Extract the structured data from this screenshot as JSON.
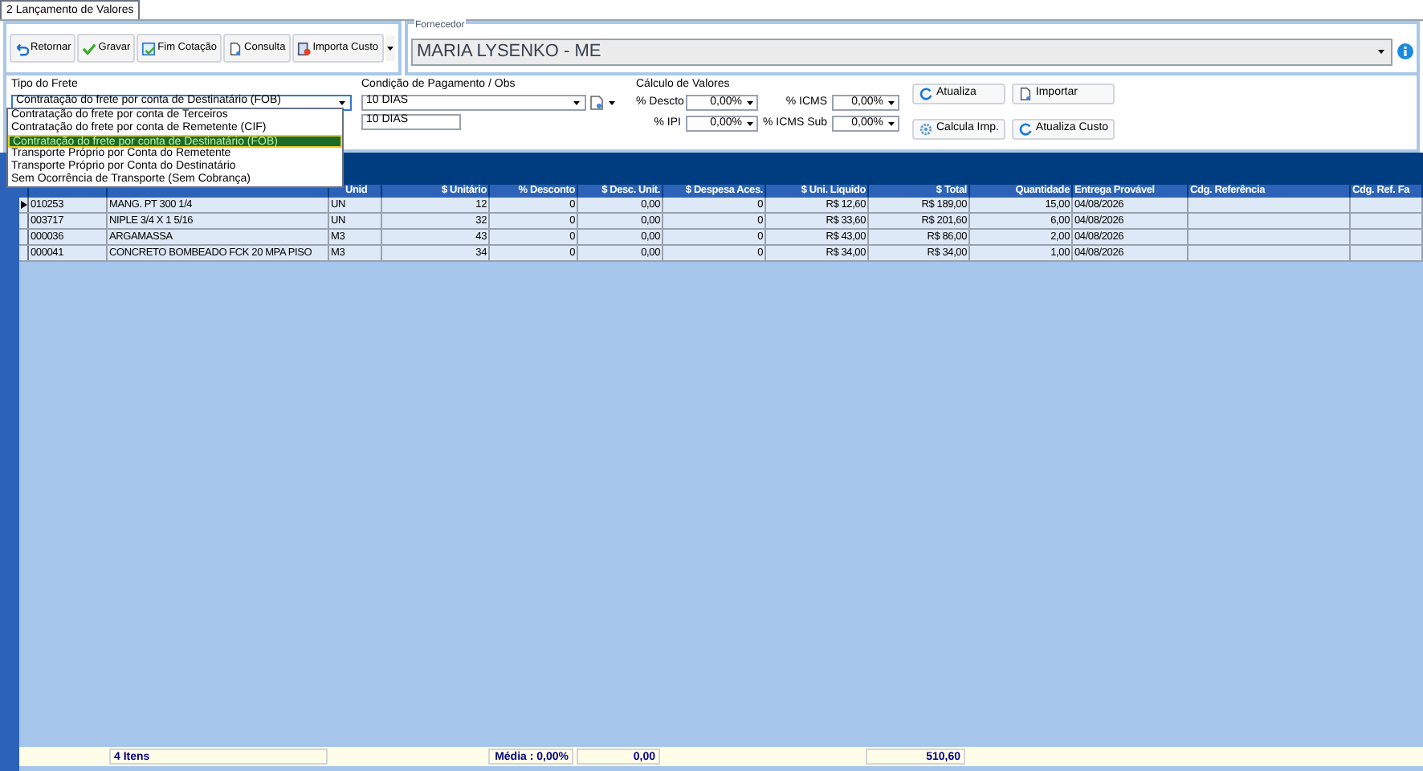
{
  "tabs": [
    {
      "label": "2 Lançamento de Valores",
      "selected": true
    }
  ],
  "toolbar": [
    {
      "label": "Retornar"
    },
    {
      "label": "Gravar"
    },
    {
      "label": "Fim Cotação"
    },
    {
      "label": "Consulta"
    },
    {
      "label": "Importa Custo"
    }
  ],
  "fornecedor": {
    "label": "Fornecedor",
    "value": "MARIA LYSENKO - ME"
  },
  "tipo_frete": {
    "label": "Tipo do Frete",
    "value": "Contratação do frete por conta de Destinatário (FOB)",
    "expanded": true,
    "options": [
      {
        "label": "Contratação do frete por conta de Terceiros",
        "selected": false
      },
      {
        "label": "Contratação do frete por conta de Remetente (CIF)",
        "selected": false
      },
      {
        "label": "Contratação do frete por conta de Destinatário (FOB)",
        "selected": true
      },
      {
        "label": "Transporte Próprio por Conta do Remetente",
        "selected": false
      },
      {
        "label": "Transporte Próprio por Conta do Destinatário",
        "selected": false
      },
      {
        "label": "Sem Ocorrência de Transporte (Sem Cobrança)",
        "selected": false
      }
    ]
  },
  "condicao": {
    "label": "Condição de Pagamento / Obs",
    "value": "10 DIAS",
    "obs": "10 DIAS"
  },
  "calculo": {
    "label": "Cálculo de Valores",
    "fields": [
      {
        "label": "% Descto",
        "value": "0,00%"
      },
      {
        "label": "% ICMS",
        "value": "0,00%"
      },
      {
        "label": "% IPI",
        "value": "0,00%"
      },
      {
        "label": "% ICMS Sub",
        "value": "0,00%"
      }
    ]
  },
  "actions": [
    {
      "label": "Atualiza"
    },
    {
      "label": "Importar"
    },
    {
      "label": "Calcula Imp."
    },
    {
      "label": "Atualiza Custo"
    }
  ],
  "table": {
    "columns": [
      "",
      "",
      "Unid",
      "$ Unitário",
      "% Desconto",
      "$ Desc. Unit.",
      "$ Despesa Aces.",
      "$ Uni. Liquido",
      "$ Total",
      "Quantidade",
      "Entrega Provável",
      "Cdg. Referência",
      "Cdg. Ref. Fa"
    ],
    "rows": [
      {
        "current": true,
        "cells": [
          "010253",
          "MANG. PT 300 1/4",
          "UN",
          "12",
          "0",
          "0,00",
          "0",
          "R$ 12,60",
          "R$ 189,00",
          "15,00",
          "04/08/2026",
          "",
          ""
        ]
      },
      {
        "current": false,
        "cells": [
          "003717",
          "NIPLE 3/4 X 1 5/16",
          "UN",
          "32",
          "0",
          "0,00",
          "0",
          "R$ 33,60",
          "R$ 201,60",
          "6,00",
          "04/08/2026",
          "",
          ""
        ]
      },
      {
        "current": false,
        "cells": [
          "000036",
          "ARGAMASSA",
          "M3",
          "43",
          "0",
          "0,00",
          "0",
          "R$ 43,00",
          "R$ 86,00",
          "2,00",
          "04/08/2026",
          "",
          ""
        ]
      },
      {
        "current": false,
        "cells": [
          "000041",
          "CONCRETO BOMBEADO FCK 20 MPA PISO",
          "M3",
          "34",
          "0",
          "0,00",
          "0",
          "R$ 34,00",
          "R$ 34,00",
          "1,00",
          "04/08/2026",
          "",
          ""
        ]
      }
    ]
  },
  "footer": {
    "count": "4 Itens",
    "media": "Média : 0,00%",
    "desc": "0,00",
    "total": "510,60"
  }
}
